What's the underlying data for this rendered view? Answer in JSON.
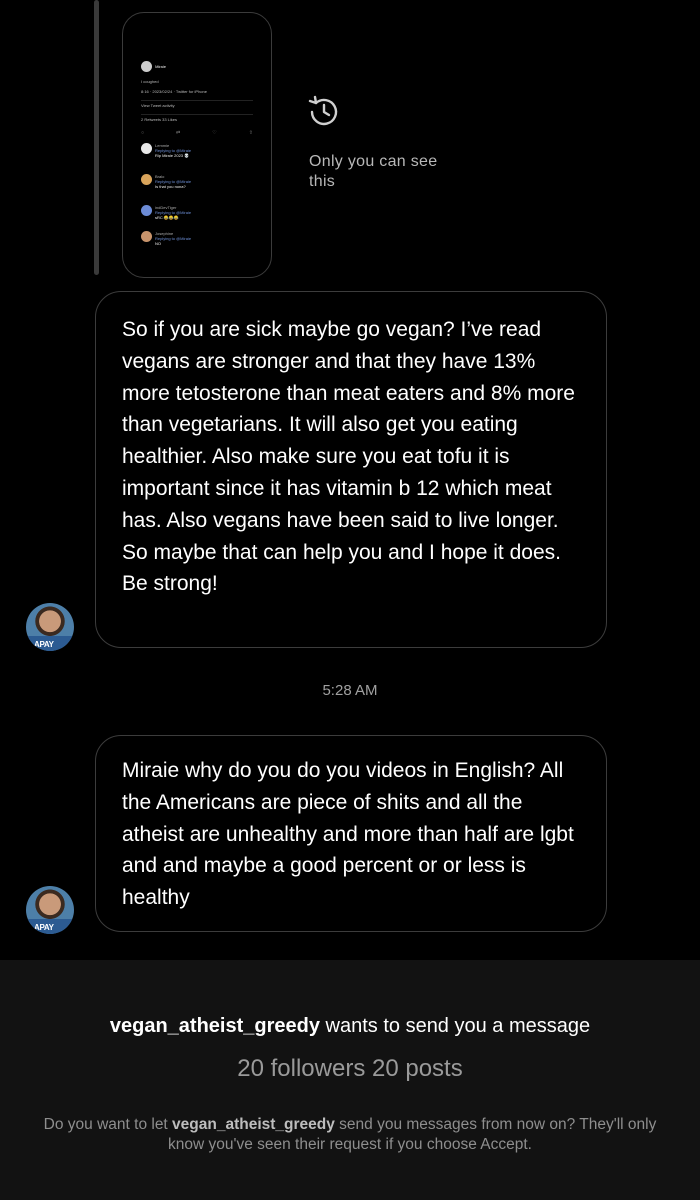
{
  "story": {
    "author": "Miraie",
    "tweet_text": "I coughed",
    "time_meta": "8:16 · 2023/02/24 · Twitter for iPhone",
    "activity": "View Tweet activity",
    "counts": "2 Retweets  33 Likes",
    "replies": [
      {
        "name": "Lemmie",
        "text": "Rip Miraie 2023 💀",
        "color": "#e8e8e8"
      },
      {
        "name": "Bralo",
        "text": "Is that you nona?",
        "color": "#d9a45b"
      },
      {
        "name": "indDevTiger",
        "text": "sRC 😂😂😂",
        "color": "#6c8bd6"
      },
      {
        "name": "Josephine",
        "text": "NO",
        "color": "#c8946c"
      }
    ],
    "only_visible_text": "Only you can see this"
  },
  "messages": [
    {
      "text": "So if you are sick maybe go vegan? I’ve read vegans are stronger and that they have 13% more tetosterone than meat eaters and 8% more than vegetarians. It will also get you eating healthier. Also make sure you eat tofu it is important since it has vitamin b 12 which meat has. Also vegans have been said to live longer. So maybe that can help you and I hope it does. Be strong!"
    },
    {
      "text": "Miraie why do you do you videos in English? All the Americans are piece of shits and all the atheist are unhealthy and more than half are lgbt and and maybe a good percent or or less is healthy"
    }
  ],
  "timestamp": "5:28 AM",
  "avatar_logo": "APAY",
  "request": {
    "username": "vegan_atheist_greedy",
    "line_suffix": " wants to send you a message",
    "stats": "20 followers 20 posts",
    "note_prefix": "Do you want to let ",
    "note_suffix": " send you messages from now on? They'll only know you've seen their request if you choose Accept."
  }
}
